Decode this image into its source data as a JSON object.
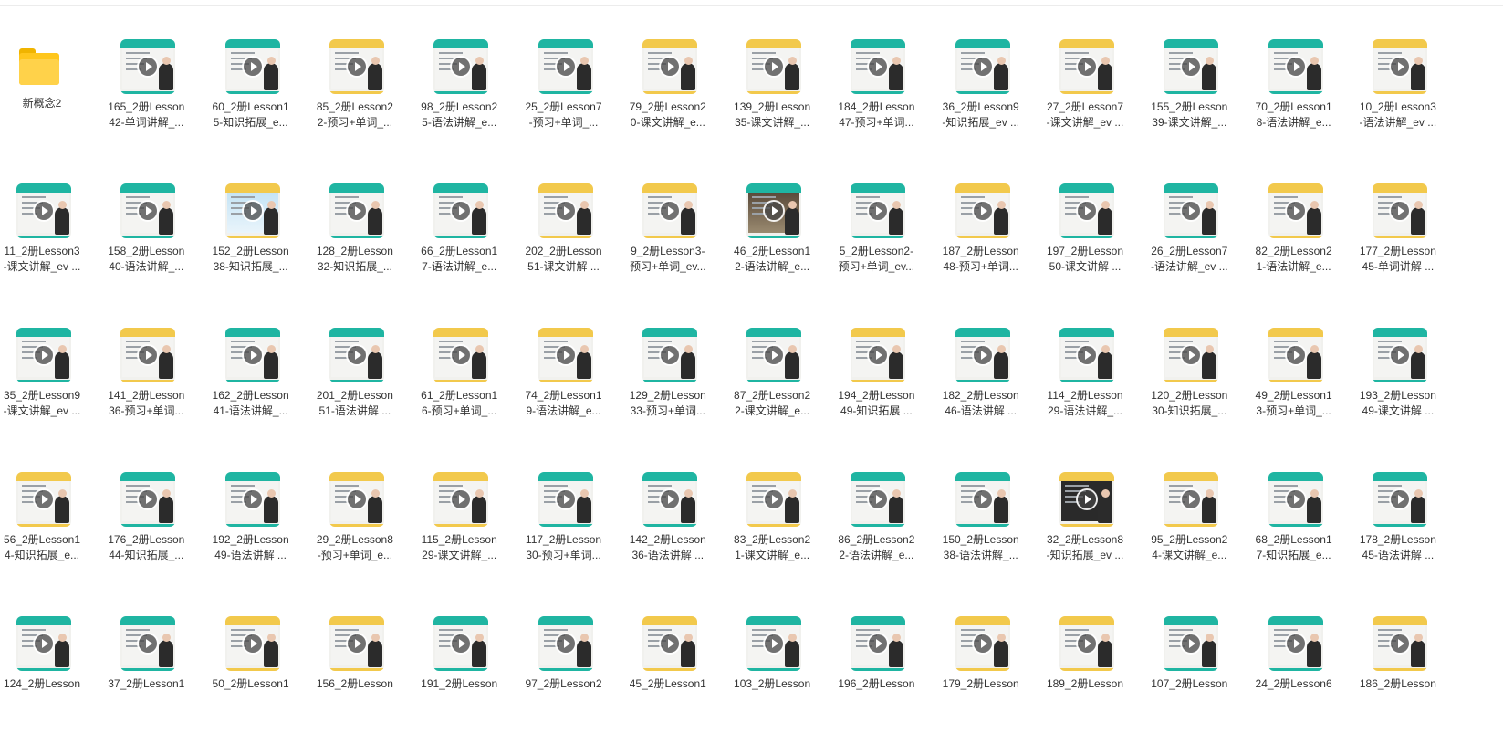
{
  "folder": {
    "name": "新概念2",
    "icon": "folder-icon"
  },
  "icons": {
    "play": "play-icon"
  },
  "colors": {
    "teal": "#1fb5a2",
    "yellow": "#f2c94c",
    "green": "#8fcf4a",
    "text": "#333333"
  },
  "files": [
    [
      "165_2册Lesson\n42-单词讲解_...",
      "60_2册Lesson1\n5-知识拓展_e...",
      "85_2册Lesson2\n2-预习+单词_...",
      "98_2册Lesson2\n5-语法讲解_e...",
      "25_2册Lesson7\n-预习+单词_...",
      "79_2册Lesson2\n0-课文讲解_e...",
      "139_2册Lesson\n35-课文讲解_...",
      "184_2册Lesson\n47-预习+单词...",
      "36_2册Lesson9\n-知识拓展_ev ...",
      "27_2册Lesson7\n-课文讲解_ev ...",
      "155_2册Lesson\n39-课文讲解_...",
      "70_2册Lesson1\n8-语法讲解_e...",
      "10_2册Lesson3\n-语法讲解_ev ..."
    ],
    [
      "11_2册Lesson3\n-课文讲解_ev ...",
      "158_2册Lesson\n40-语法讲解_...",
      "152_2册Lesson\n38-知识拓展_...",
      "128_2册Lesson\n32-知识拓展_...",
      "66_2册Lesson1\n7-语法讲解_e...",
      "202_2册Lesson\n51-课文讲解 ...",
      "9_2册Lesson3-\n预习+单词_ev...",
      "46_2册Lesson1\n2-语法讲解_e...",
      "5_2册Lesson2-\n预习+单词_ev...",
      "187_2册Lesson\n48-预习+单词...",
      "197_2册Lesson\n50-课文讲解 ...",
      "26_2册Lesson7\n-语法讲解_ev ...",
      "82_2册Lesson2\n1-语法讲解_e...",
      "177_2册Lesson\n45-单词讲解 ..."
    ],
    [
      "35_2册Lesson9\n-课文讲解_ev ...",
      "141_2册Lesson\n36-预习+单词...",
      "162_2册Lesson\n41-语法讲解_...",
      "201_2册Lesson\n51-语法讲解 ...",
      "61_2册Lesson1\n6-预习+单词_...",
      "74_2册Lesson1\n9-语法讲解_e...",
      "129_2册Lesson\n33-预习+单词...",
      "87_2册Lesson2\n2-课文讲解_e...",
      "194_2册Lesson\n49-知识拓展 ...",
      "182_2册Lesson\n46-语法讲解 ...",
      "114_2册Lesson\n29-语法讲解_...",
      "120_2册Lesson\n30-知识拓展_...",
      "49_2册Lesson1\n3-预习+单词_...",
      "193_2册Lesson\n49-课文讲解 ..."
    ],
    [
      "56_2册Lesson1\n4-知识拓展_e...",
      "176_2册Lesson\n44-知识拓展_...",
      "192_2册Lesson\n49-语法讲解 ...",
      "29_2册Lesson8\n-预习+单词_e...",
      "115_2册Lesson\n29-课文讲解_...",
      "117_2册Lesson\n30-预习+单词...",
      "142_2册Lesson\n36-语法讲解 ...",
      "83_2册Lesson2\n1-课文讲解_e...",
      "86_2册Lesson2\n2-语法讲解_e...",
      "150_2册Lesson\n38-语法讲解_...",
      "32_2册Lesson8\n-知识拓展_ev ...",
      "95_2册Lesson2\n4-课文讲解_e...",
      "68_2册Lesson1\n7-知识拓展_e...",
      "178_2册Lesson\n45-语法讲解 ..."
    ],
    [
      "124_2册Lesson",
      "37_2册Lesson1",
      "50_2册Lesson1",
      "156_2册Lesson",
      "191_2册Lesson",
      "97_2册Lesson2",
      "45_2册Lesson1",
      "103_2册Lesson",
      "196_2册Lesson",
      "179_2册Lesson",
      "189_2册Lesson",
      "107_2册Lesson",
      "24_2册Lesson6",
      "186_2册Lesson"
    ]
  ]
}
